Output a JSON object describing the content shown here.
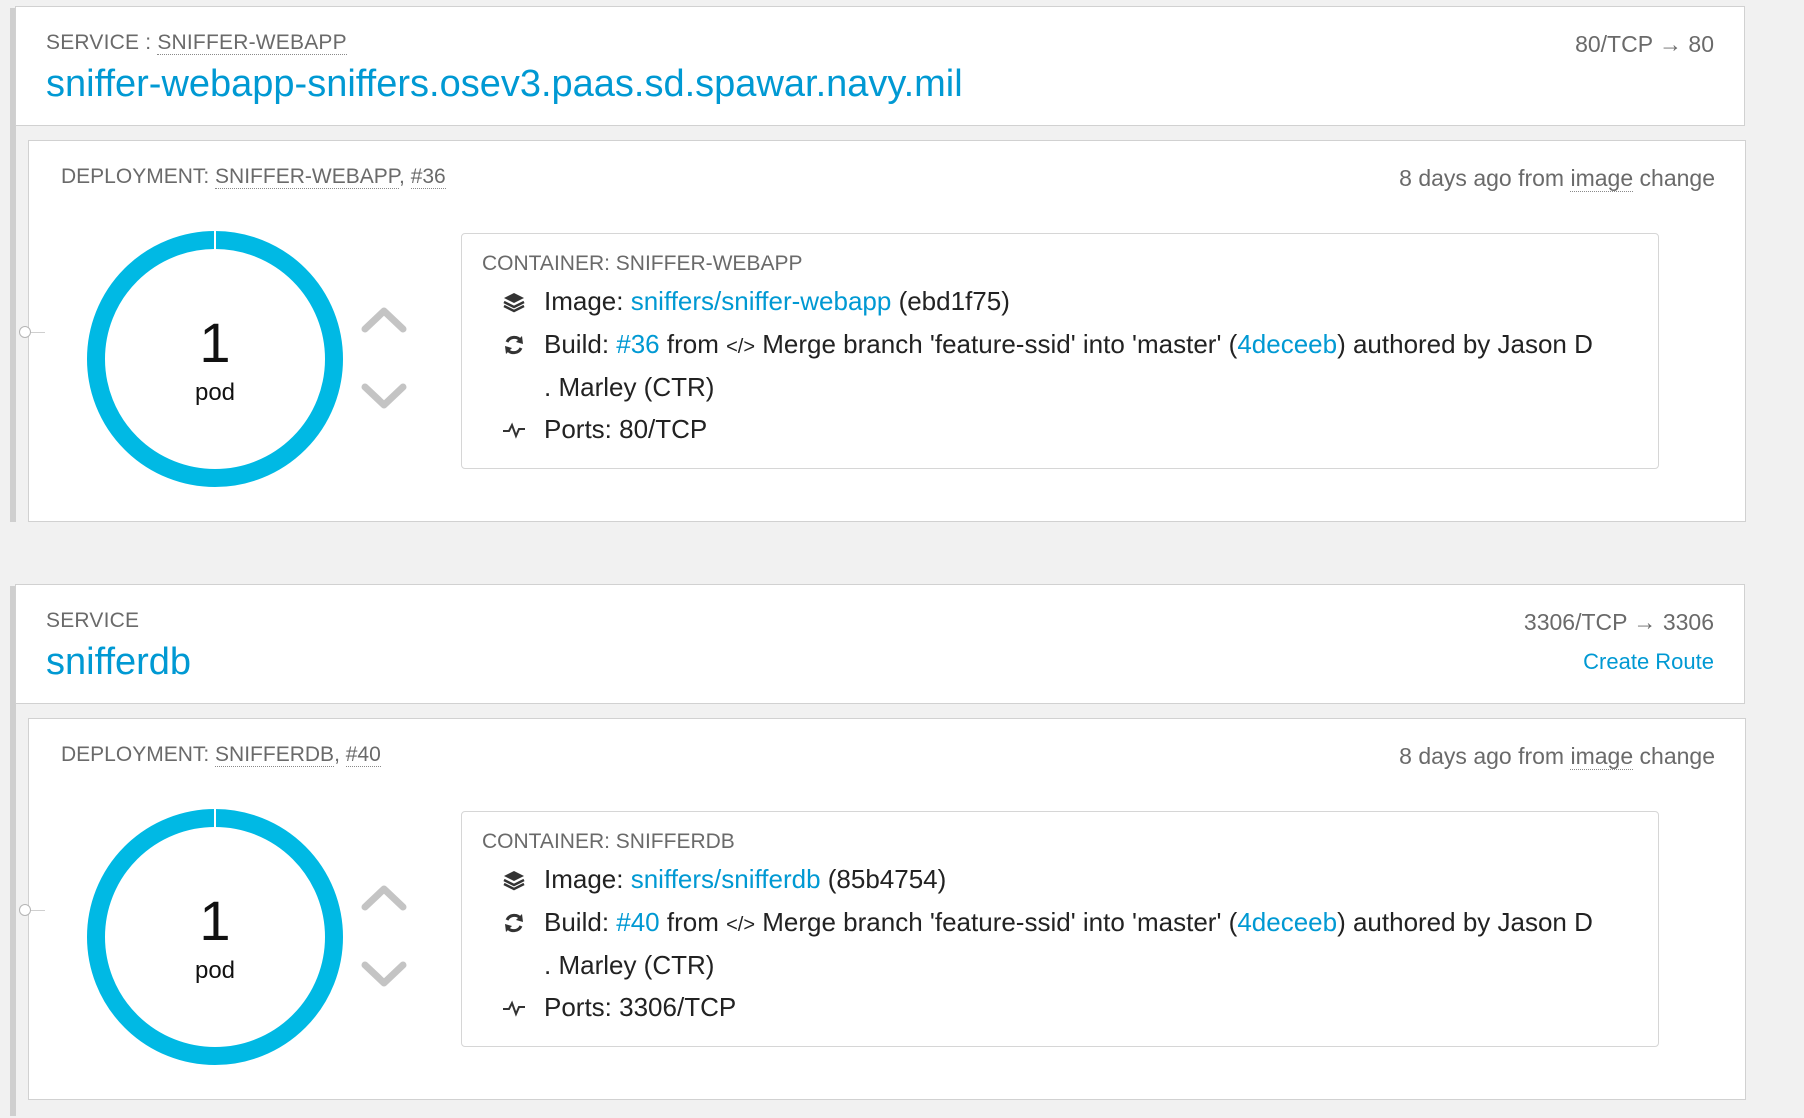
{
  "services": [
    {
      "label_prefix": "SERVICE : ",
      "label_name": "SNIFFER-WEBAPP",
      "name": "sniffer-webapp-sniffers.osev3.paas.sd.spawar.navy.mil",
      "ports": "80/TCP → 80",
      "create_route": "",
      "deployment": {
        "label_prefix": "DEPLOYMENT: ",
        "label_name": "SNIFFER-WEBAPP",
        "label_sep": ", ",
        "number": "#36",
        "age_prefix": "8 days ago from ",
        "age_trigger": "image",
        "age_suffix": " change",
        "pods": "1",
        "pods_unit": "pod",
        "container": {
          "label": "CONTAINER: SNIFFER-WEBAPP",
          "image_label": "Image: ",
          "image_link": "sniffers/sniffer-webapp",
          "image_hash": " (ebd1f75)",
          "build_label": "Build: ",
          "build_link": "#36",
          "build_from": " from ",
          "build_code": "</>",
          "build_msg": " Merge branch 'feature-ssid' into 'master' (",
          "commit_link": "4deceeb",
          "build_author_a": ") authored by Jason D",
          "build_author_b": ". Marley (CTR)",
          "ports": "Ports: 80/TCP"
        }
      }
    },
    {
      "label_prefix": "SERVICE",
      "label_name": "",
      "name": "snifferdb",
      "ports": "3306/TCP → 3306",
      "create_route": "Create Route",
      "deployment": {
        "label_prefix": "DEPLOYMENT: ",
        "label_name": "SNIFFERDB",
        "label_sep": ", ",
        "number": "#40",
        "age_prefix": "8 days ago from ",
        "age_trigger": "image",
        "age_suffix": " change",
        "pods": "1",
        "pods_unit": "pod",
        "container": {
          "label": "CONTAINER: SNIFFERDB",
          "image_label": "Image: ",
          "image_link": "sniffers/snifferdb",
          "image_hash": " (85b4754)",
          "build_label": "Build: ",
          "build_link": "#40",
          "build_from": " from ",
          "build_code": "</>",
          "build_msg": " Merge branch 'feature-ssid' into 'master' (",
          "commit_link": "4deceeb",
          "build_author_a": ") authored by Jason D",
          "build_author_b": ". Marley (CTR)",
          "ports": "Ports: 3306/TCP"
        }
      }
    }
  ],
  "colors": {
    "accent": "#0099d3",
    "donut": "#00b9e4"
  },
  "icons": {
    "image": "layers-icon",
    "build": "refresh-icon",
    "ports": "pulse-icon",
    "scale_up": "chevron-up-icon",
    "scale_down": "chevron-down-icon"
  }
}
